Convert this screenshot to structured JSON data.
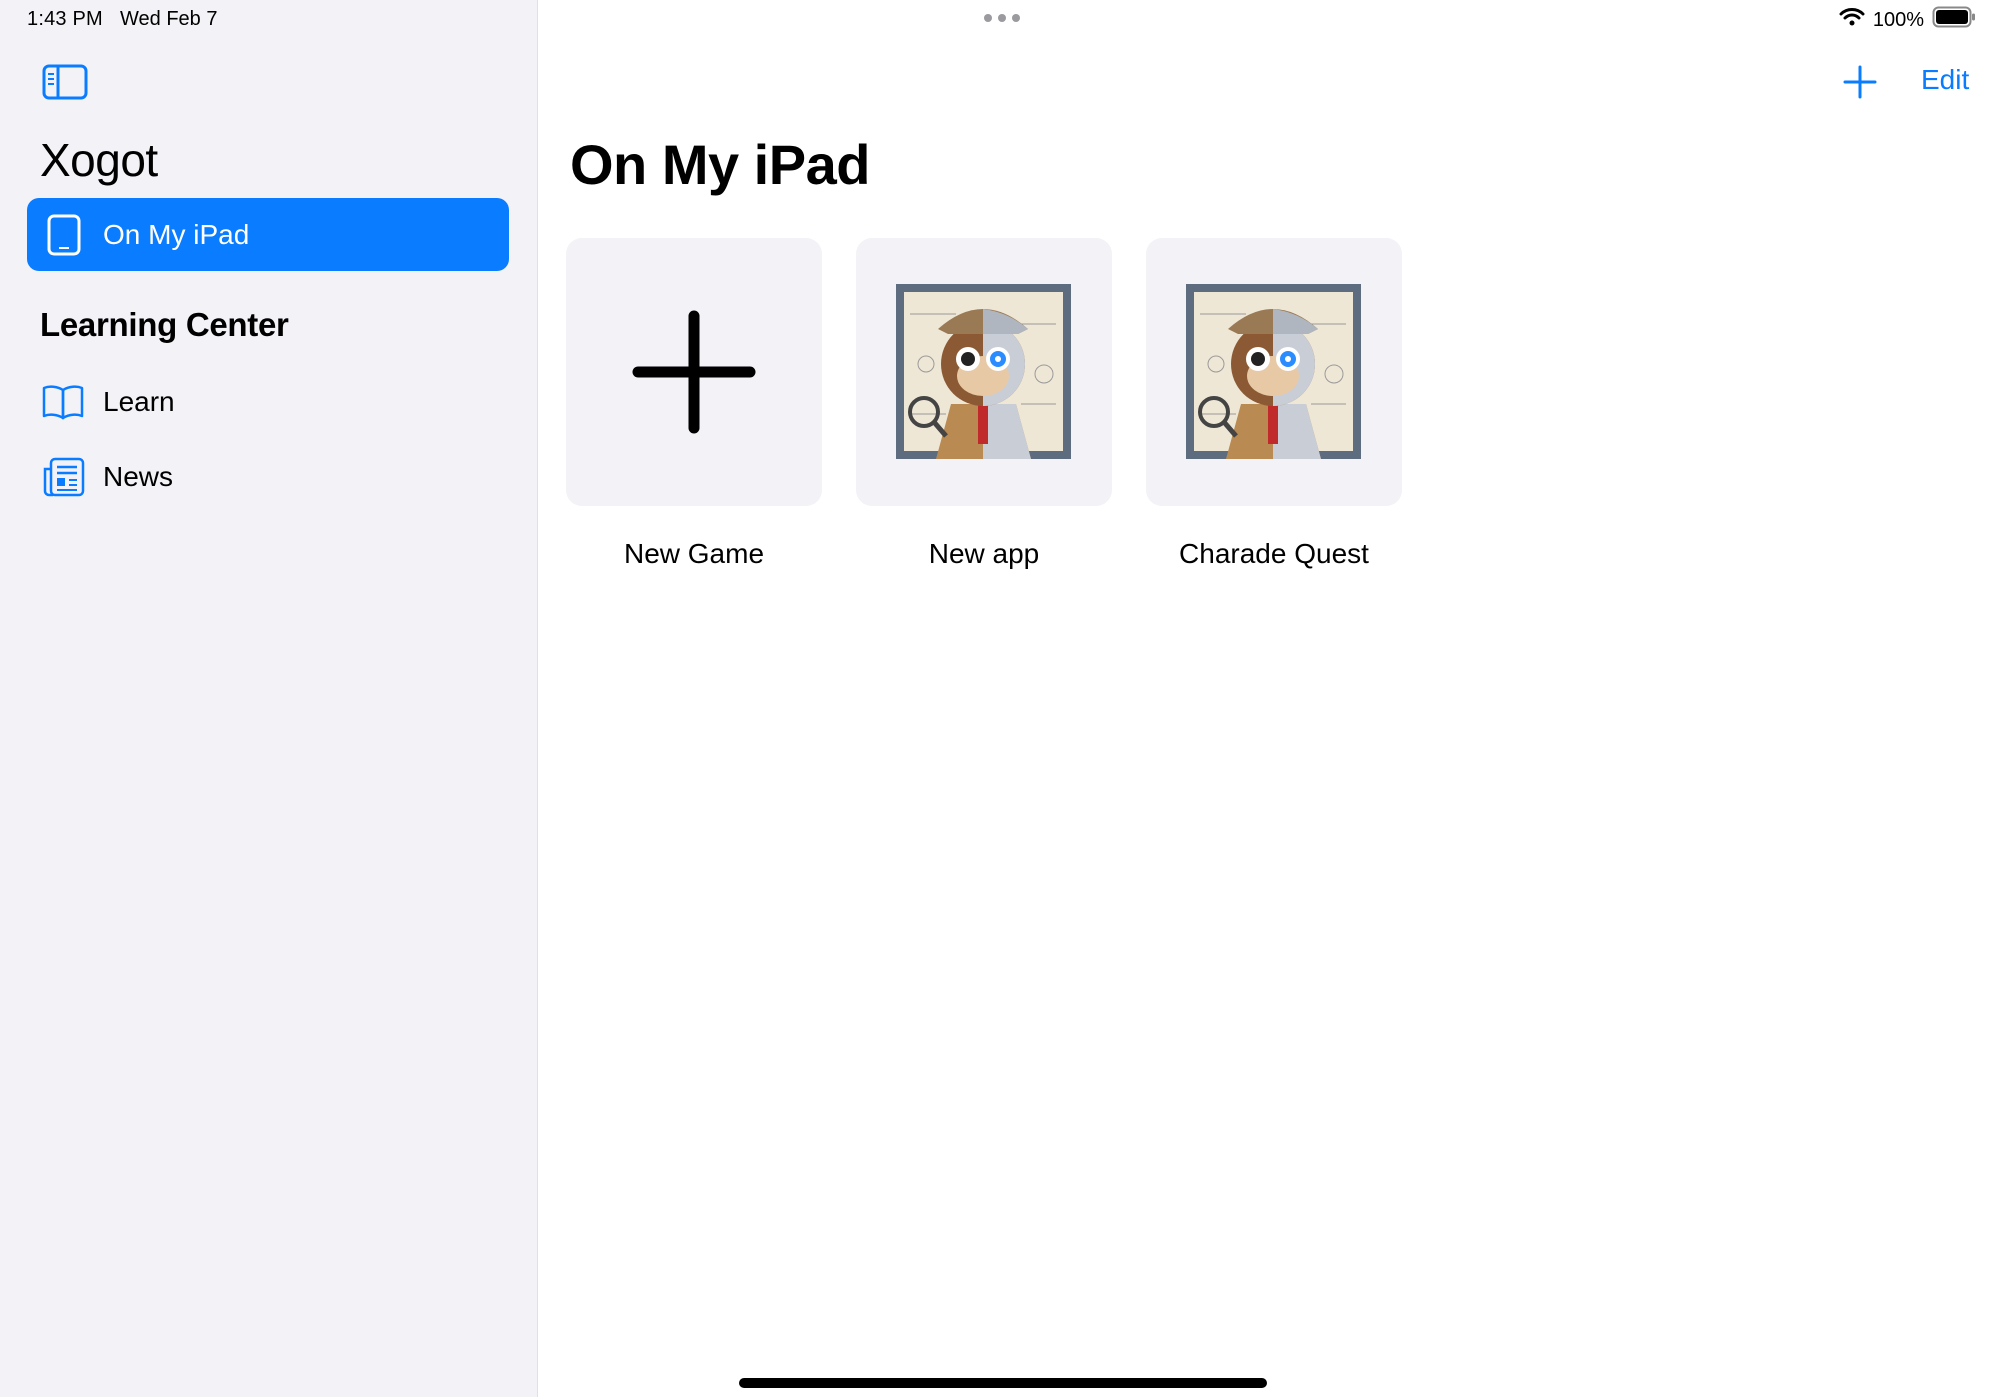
{
  "status_bar": {
    "time": "1:43 PM",
    "date": "Wed Feb 7",
    "battery": "100%"
  },
  "sidebar": {
    "app_title": "Xogot",
    "selected_item": {
      "label": "On My iPad",
      "icon": "ipad-icon"
    },
    "section_header": "Learning Center",
    "items": [
      {
        "label": "Learn",
        "icon": "book-icon"
      },
      {
        "label": "News",
        "icon": "newspaper-icon"
      }
    ]
  },
  "toolbar": {
    "add_icon": "plus-icon",
    "edit_label": "Edit"
  },
  "main": {
    "title": "On My iPad",
    "tiles": [
      {
        "label": "New Game",
        "icon": "plus-icon"
      },
      {
        "label": "New app",
        "thumbnail": "monkey-detective-robot-thumbnail"
      },
      {
        "label": "Charade Quest",
        "thumbnail": "monkey-detective-robot-thumbnail"
      }
    ]
  },
  "colors": {
    "accent": "#0a7cff",
    "sidebar_bg": "#f2f2f7",
    "tile_bg": "#f2f2f7"
  }
}
